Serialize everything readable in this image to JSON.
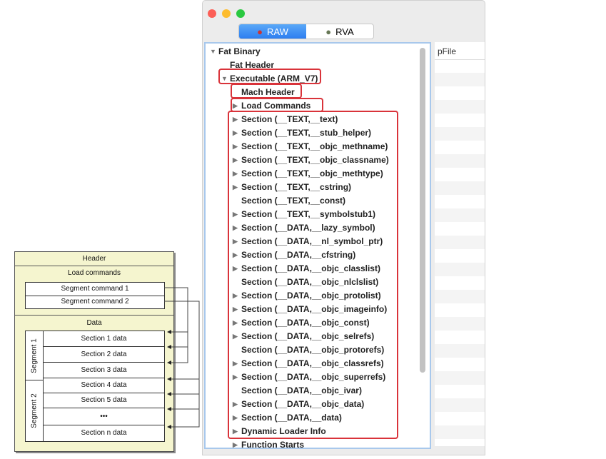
{
  "diagram": {
    "header": "Header",
    "load_commands": "Load commands",
    "segment_commands": [
      "Segment command 1",
      "Segment command 2"
    ],
    "data": "Data",
    "segments": [
      "Segment 1",
      "Segment 2"
    ],
    "sections": [
      "Section 1 data",
      "Section 2 data",
      "Section 3 data",
      "Section 4 data",
      "Section 5 data",
      "•••",
      "Section n data"
    ]
  },
  "window": {
    "tabs": [
      {
        "label": "RAW",
        "selected": true
      },
      {
        "label": "RVA",
        "selected": false
      }
    ],
    "column_header": "pFile"
  },
  "tree": [
    {
      "label": "Fat Binary",
      "level": 0,
      "arrow": "expanded"
    },
    {
      "label": "Fat Header",
      "level": 1,
      "arrow": "none"
    },
    {
      "label": "Executable  (ARM_V7)",
      "level": 1,
      "arrow": "expanded"
    },
    {
      "label": "Mach Header",
      "level": 2,
      "arrow": "none"
    },
    {
      "label": "Load Commands",
      "level": 2,
      "arrow": "collapsed"
    },
    {
      "label": "Section (__TEXT,__text)",
      "level": 2,
      "arrow": "collapsed"
    },
    {
      "label": "Section (__TEXT,__stub_helper)",
      "level": 2,
      "arrow": "collapsed"
    },
    {
      "label": "Section (__TEXT,__objc_methname)",
      "level": 2,
      "arrow": "collapsed"
    },
    {
      "label": "Section (__TEXT,__objc_classname)",
      "level": 2,
      "arrow": "collapsed"
    },
    {
      "label": "Section (__TEXT,__objc_methtype)",
      "level": 2,
      "arrow": "collapsed"
    },
    {
      "label": "Section (__TEXT,__cstring)",
      "level": 2,
      "arrow": "collapsed"
    },
    {
      "label": "Section (__TEXT,__const)",
      "level": 2,
      "arrow": "none"
    },
    {
      "label": "Section (__TEXT,__symbolstub1)",
      "level": 2,
      "arrow": "collapsed"
    },
    {
      "label": "Section (__DATA,__lazy_symbol)",
      "level": 2,
      "arrow": "collapsed"
    },
    {
      "label": "Section (__DATA,__nl_symbol_ptr)",
      "level": 2,
      "arrow": "collapsed"
    },
    {
      "label": "Section (__DATA,__cfstring)",
      "level": 2,
      "arrow": "collapsed"
    },
    {
      "label": "Section (__DATA,__objc_classlist)",
      "level": 2,
      "arrow": "collapsed"
    },
    {
      "label": "Section (__DATA,__objc_nlclslist)",
      "level": 2,
      "arrow": "none"
    },
    {
      "label": "Section (__DATA,__objc_protolist)",
      "level": 2,
      "arrow": "collapsed"
    },
    {
      "label": "Section (__DATA,__objc_imageinfo)",
      "level": 2,
      "arrow": "collapsed"
    },
    {
      "label": "Section (__DATA,__objc_const)",
      "level": 2,
      "arrow": "collapsed"
    },
    {
      "label": "Section (__DATA,__objc_selrefs)",
      "level": 2,
      "arrow": "collapsed"
    },
    {
      "label": "Section (__DATA,__objc_protorefs)",
      "level": 2,
      "arrow": "none"
    },
    {
      "label": "Section (__DATA,__objc_classrefs)",
      "level": 2,
      "arrow": "collapsed"
    },
    {
      "label": "Section (__DATA,__objc_superrefs)",
      "level": 2,
      "arrow": "collapsed"
    },
    {
      "label": "Section (__DATA,__objc_ivar)",
      "level": 2,
      "arrow": "none"
    },
    {
      "label": "Section (__DATA,__objc_data)",
      "level": 2,
      "arrow": "collapsed"
    },
    {
      "label": "Section (__DATA,__data)",
      "level": 2,
      "arrow": "collapsed"
    },
    {
      "label": "Dynamic Loader Info",
      "level": 2,
      "arrow": "collapsed"
    },
    {
      "label": "Function Starts",
      "level": 2,
      "arrow": "collapsed"
    }
  ],
  "colors": {
    "highlight": "#d9333a",
    "selected_tab": "#2d7ef0"
  }
}
